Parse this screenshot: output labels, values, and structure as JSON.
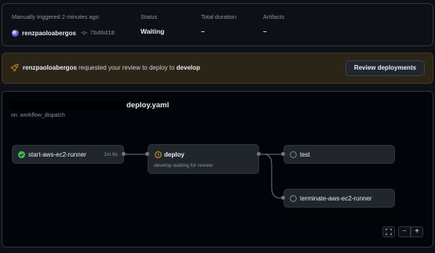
{
  "summary": {
    "trigger_text": "Manually triggered 2 minutes ago",
    "actor": "renzpaoloabergos",
    "commit_sha": "7bd6d18",
    "status_label": "Status",
    "status_value": "Waiting",
    "duration_label": "Total duration",
    "duration_value": "–",
    "artifacts_label": "Artifacts",
    "artifacts_value": "–"
  },
  "review_banner": {
    "actor": "renzpaoloabergos",
    "message_mid": "requested your review to deploy to",
    "environment": "develop",
    "button_label": "Review deployments",
    "accent": "#d29922"
  },
  "workflow": {
    "file_name": "deploy.yaml",
    "trigger": "on: workflow_dispatch"
  },
  "jobs": {
    "start_runner": {
      "name": "start-aws-ec2-runner",
      "duration": "1m 6s",
      "status": "success",
      "color": "#3fb950"
    },
    "deploy": {
      "name": "deploy",
      "subtitle": "develop waiting for review",
      "status": "waiting",
      "color": "#d29922"
    },
    "test": {
      "name": "test",
      "status": "pending"
    },
    "terminate_runner": {
      "name": "terminate-aws-ec2-runner",
      "status": "pending"
    }
  },
  "zoom_controls": {
    "fullscreen_icon": "fullscreen-icon",
    "zoom_out": "−",
    "zoom_in": "+"
  }
}
